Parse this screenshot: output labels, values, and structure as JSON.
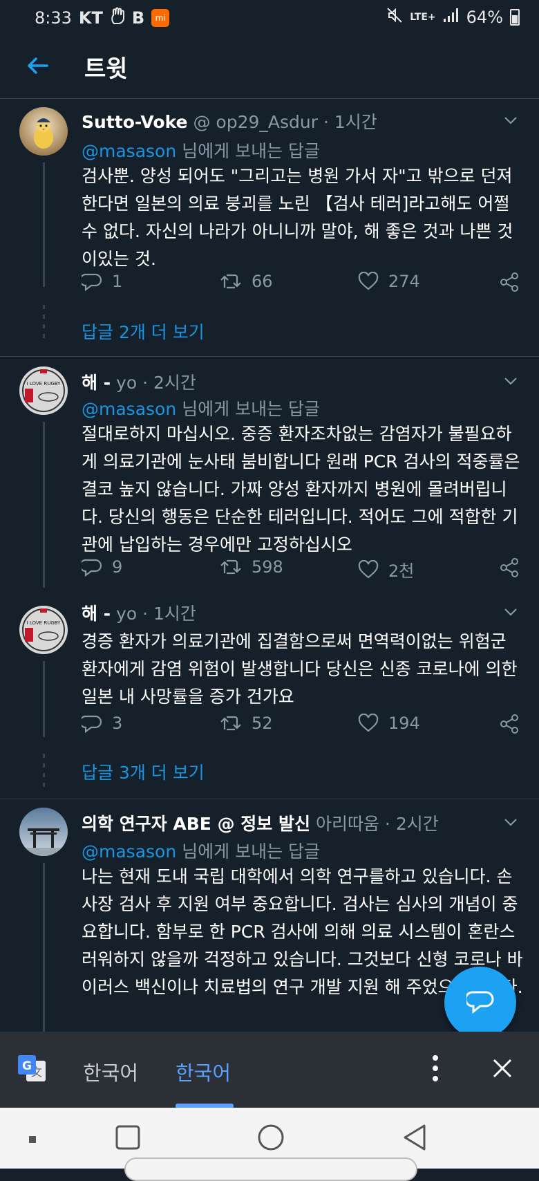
{
  "status_bar": {
    "time": "8:33",
    "carrier": "KT",
    "b_label": "B",
    "mi_label": "mi",
    "lte_label": "LTE+",
    "battery": "64%"
  },
  "header": {
    "title": "트윗"
  },
  "tweets": [
    {
      "name": "Sutto-Voke",
      "handle": "@ op29_Asdur",
      "time": "· 1시간",
      "reply_mention": "@masason",
      "reply_suffix": " 님에게 보내는 답글",
      "text": "검사뿐. 양성 되어도 \"그리고는 병원 가서 자\"고 밖으로 던져한다면 일본의 의료 붕괴를 노린 【검사 테러]라고해도 어쩔 수 없다. 자신의 나라가 아니니까 말야, 해 좋은 것과 나쁜 것이있는 것.",
      "replies": "1",
      "retweets": "66",
      "likes": "274",
      "more": "답글 2개 더 보기"
    },
    {
      "name": "해 -",
      "handle": "yo",
      "time": "· 2시간",
      "reply_mention": "@masason",
      "reply_suffix": " 님에게 보내는 답글",
      "text": "절대로하지 마십시오. 중증 환자조차없는 감염자가 불필요하게 의료기관에 눈사태 붐비합니다 원래 PCR 검사의 적중률은 결코 높지 않습니다. 가짜 양성 환자까지 병원에 몰려버립니다. 당신의 행동은 단순한 테러입니다. 적어도 그에 적합한 기관에 납입하는 경우에만 고정하십시오",
      "replies": "9",
      "retweets": "598",
      "likes": "2천",
      "avatar_text": "I LOVE RUGBY"
    },
    {
      "name": "해 -",
      "handle": "yo",
      "time": "· 1시간",
      "text": "경증 환자가 의료기관에 집결함으로써 면역력이없는 위험군 환자에게 감염 위험이 발생합니다 당신은 신종 코로나에 의한 일본 내 사망률을 증가 건가요",
      "replies": "3",
      "retweets": "52",
      "likes": "194",
      "more": "답글 3개 더 보기",
      "avatar_text": "I LOVE RUGBY"
    },
    {
      "name": "의학 연구자 ABE @ 정보 발신",
      "handle": "아리따움",
      "time": "· 2시간",
      "reply_mention": "@masason",
      "reply_suffix": " 님에게 보내는 답글",
      "text": "나는 현재 도내 국립 대학에서 의학 연구를하고 있습니다. 손 사장 검사 후 지원 여부 중요합니다. 검사는 심사의 개념이 중요합니다. 함부로 한 PCR 검사에 의해 의료 시스템이 혼란스러워하지 않을까 걱정하고 있습니다. 그것보다 신형 코로나 바이러스 백신이나 치료법의 연구 개발 지원 해 주었으면합니다."
    }
  ],
  "translate_bar": {
    "source_lang": "한국어",
    "target_lang": "한국어"
  },
  "colors": {
    "background": "#15202b",
    "accent": "#1da1f2",
    "link": "#1b95e0",
    "muted": "#8899a6",
    "divider": "#38444d"
  }
}
